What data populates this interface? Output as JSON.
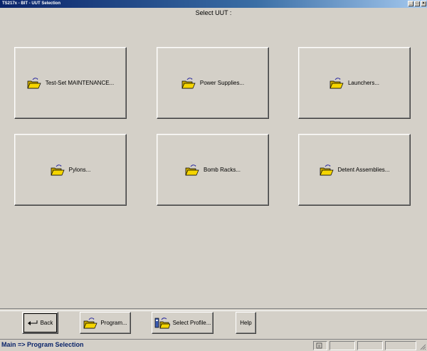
{
  "window": {
    "title": "TS217x - BIT - UUT Selection"
  },
  "header": {
    "title": "Select UUT :"
  },
  "tiles": [
    {
      "label": "Test-Set MAINTENANCE..."
    },
    {
      "label": "Power Supplies..."
    },
    {
      "label": "Launchers..."
    },
    {
      "label": "Pylons..."
    },
    {
      "label": "Bomb Racks..."
    },
    {
      "label": "Detent Assemblies..."
    }
  ],
  "buttons": {
    "back": "Back",
    "program": "Program...",
    "select_profile": "Select Profile...",
    "help": "Help"
  },
  "status": {
    "text": "Main => Program Selection"
  },
  "icons": {
    "folder": "open-folder-icon",
    "back": "return-arrow-icon",
    "profile": "profile-folder-icon"
  },
  "colors": {
    "background": "#d4d0c8",
    "titlebar": "#0a246a",
    "status_text": "#0a246a",
    "folder": "#f5d500"
  }
}
